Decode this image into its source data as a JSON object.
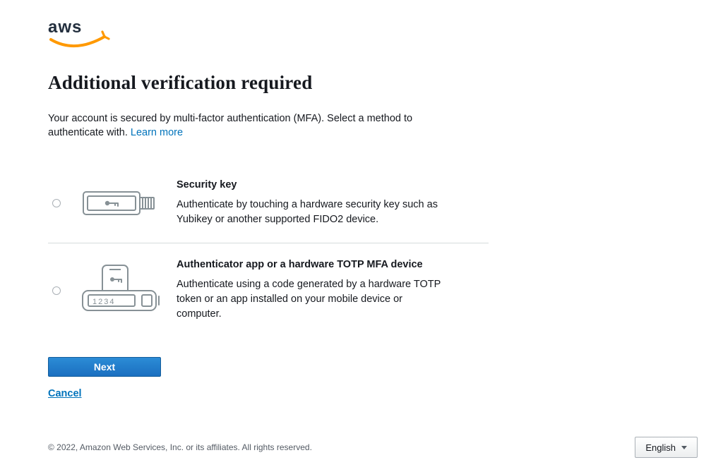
{
  "header": {
    "logo_name": "aws-logo"
  },
  "page": {
    "title": "Additional verification required",
    "intro": "Your account is secured by multi-factor authentication (MFA). Select a method to authenticate with. ",
    "learn_more": "Learn more"
  },
  "options": [
    {
      "id": "security-key",
      "title": "Security key",
      "description": "Authenticate by touching a hardware security key such as Yubikey or another supported FIDO2 device.",
      "icon": "security-key-icon"
    },
    {
      "id": "authenticator-app",
      "title": "Authenticator app or a hardware TOTP MFA device",
      "description": "Authenticate using a code generated by a hardware TOTP token or an app installed on your mobile device or computer.",
      "icon": "authenticator-icon",
      "token_digits": "1234"
    }
  ],
  "actions": {
    "next": "Next",
    "cancel": "Cancel"
  },
  "footer": {
    "copyright": "© 2022, Amazon Web Services, Inc. or its affiliates. All rights reserved.",
    "language": "English"
  }
}
